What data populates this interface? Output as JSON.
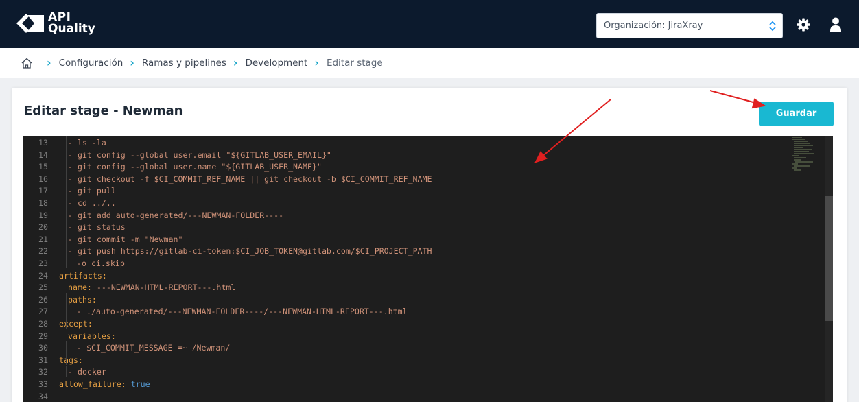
{
  "header": {
    "logo_line1": "API",
    "logo_line2": "Quality",
    "org_select_value": "Organización: JiraXray"
  },
  "breadcrumb": {
    "items": [
      "Configuración",
      "Ramas y pipelines",
      "Development",
      "Editar stage"
    ]
  },
  "page": {
    "title": "Editar stage - Newman",
    "save_label": "Guardar"
  },
  "editor": {
    "lines": [
      {
        "n": "13",
        "text": "- ls -la"
      },
      {
        "n": "14",
        "text": "- git config --global user.email \"${GITLAB_USER_EMAIL}\""
      },
      {
        "n": "15",
        "text": "- git config --global user.name \"${GITLAB_USER_NAME}\""
      },
      {
        "n": "16",
        "text": "- git checkout -f $CI_COMMIT_REF_NAME || git checkout -b $CI_COMMIT_REF_NAME"
      },
      {
        "n": "17",
        "text": "- git pull"
      },
      {
        "n": "18",
        "text": "- cd ../.."
      },
      {
        "n": "19",
        "text": "- git add auto-generated/---NEWMAN-FOLDER----"
      },
      {
        "n": "20",
        "text": "- git status"
      },
      {
        "n": "21",
        "text": "- git commit -m \"Newman\""
      },
      {
        "n": "22",
        "text": "- git push https://gitlab-ci-token:$CI_JOB_TOKEN@gitlab.com/$CI_PROJECT_PATH"
      },
      {
        "n": "23",
        "text": "-o ci.skip"
      },
      {
        "n": "24",
        "text": "artifacts:"
      },
      {
        "n": "25",
        "text": "name: ---NEWMAN-HTML-REPORT---.html"
      },
      {
        "n": "26",
        "text": "paths:"
      },
      {
        "n": "27",
        "text": "- ./auto-generated/---NEWMAN-FOLDER----/---NEWMAN-HTML-REPORT---.html"
      },
      {
        "n": "28",
        "text": "except:"
      },
      {
        "n": "29",
        "text": "variables:"
      },
      {
        "n": "30",
        "text": "- $CI_COMMIT_MESSAGE =~ /Newman/"
      },
      {
        "n": "31",
        "text": "tags:"
      },
      {
        "n": "32",
        "text": "- docker"
      },
      {
        "n": "33",
        "text": "allow_failure: true"
      },
      {
        "n": "34",
        "text": ""
      }
    ]
  },
  "icons": {
    "home": "home-icon",
    "breadcrumb_separator": "chevron-right-icon",
    "org_select": "up-down-arrows-icon",
    "settings": "gear-icon",
    "user": "user-icon"
  },
  "colors": {
    "navbar": "#0c1a2d",
    "accent": "#19b8d2",
    "breadcrumb_separator": "#1aa6c9",
    "editor_bg": "#1e1e1e",
    "annotation_arrow": "#e02020"
  }
}
